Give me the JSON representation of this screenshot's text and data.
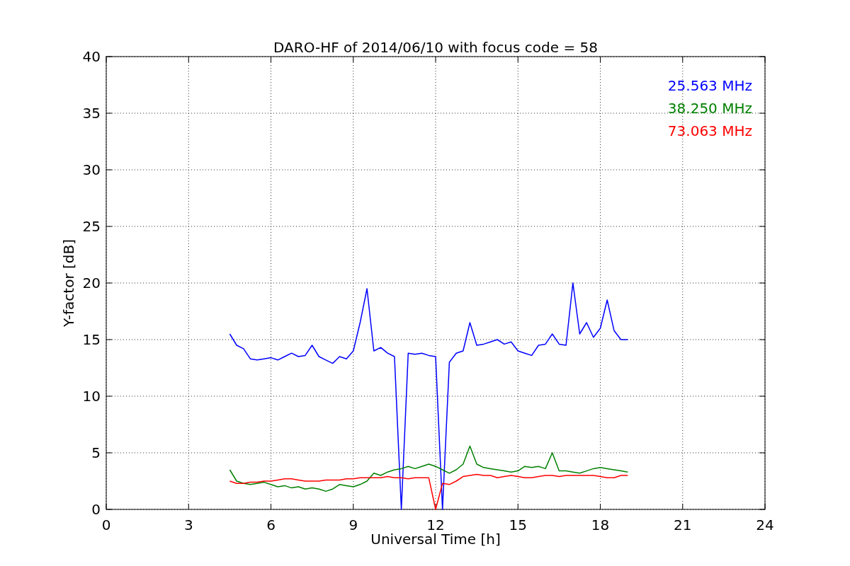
{
  "figure": {
    "chart_data": {
      "type": "line",
      "title": "DARO-HF of 2014/06/10 with focus code = 58",
      "xlabel": "Universal Time [h]",
      "ylabel": "Y-factor [dB]",
      "x": [
        4.5,
        4.75,
        5,
        5.25,
        5.5,
        5.75,
        6,
        6.25,
        6.5,
        6.75,
        7,
        7.25,
        7.5,
        7.75,
        8,
        8.25,
        8.5,
        8.75,
        9,
        9.25,
        9.5,
        9.75,
        10,
        10.25,
        10.5,
        10.75,
        11,
        11.25,
        11.5,
        11.75,
        12,
        12.25,
        12.5,
        12.75,
        13,
        13.25,
        13.5,
        13.75,
        14,
        14.25,
        14.5,
        14.75,
        15,
        15.25,
        15.5,
        15.75,
        16,
        16.25,
        16.5,
        16.75,
        17,
        17.25,
        17.5,
        17.75,
        18,
        18.25,
        18.5,
        18.75,
        19
      ],
      "series": [
        {
          "name": "25.563 MHz",
          "color": "#0000ff",
          "values": [
            15.5,
            14.5,
            14.2,
            13.3,
            13.2,
            13.3,
            13.4,
            13.2,
            13.5,
            13.8,
            13.5,
            13.6,
            14.5,
            13.5,
            13.2,
            12.9,
            13.5,
            13.3,
            14.0,
            16.5,
            19.5,
            14.0,
            14.3,
            13.8,
            13.5,
            0,
            13.8,
            13.7,
            13.8,
            13.6,
            13.5,
            0,
            13.0,
            13.8,
            14.0,
            16.5,
            14.5,
            14.6,
            14.8,
            15.0,
            14.6,
            14.8,
            14.0,
            13.8,
            13.6,
            14.5,
            14.6,
            15.5,
            14.6,
            14.5,
            20,
            15.5,
            16.5,
            15.2,
            16,
            18.5,
            15.8,
            15.0,
            15.0
          ]
        },
        {
          "name": "38.250 MHz",
          "color": "#008000",
          "values": [
            3.5,
            2.5,
            2.3,
            2.2,
            2.3,
            2.4,
            2.2,
            2.0,
            2.1,
            1.9,
            2.0,
            1.8,
            1.9,
            1.8,
            1.6,
            1.8,
            2.2,
            2.1,
            2.0,
            2.2,
            2.5,
            3.2,
            3.0,
            3.3,
            3.5,
            3.6,
            3.8,
            3.6,
            3.8,
            4.0,
            3.8,
            3.5,
            3.2,
            3.5,
            4.0,
            5.6,
            4.0,
            3.7,
            3.6,
            3.5,
            3.4,
            3.3,
            3.4,
            3.8,
            3.7,
            3.8,
            3.6,
            5.0,
            3.4,
            3.4,
            3.3,
            3.2,
            3.4,
            3.6,
            3.7,
            3.6,
            3.5,
            3.4,
            3.3
          ]
        },
        {
          "name": "73.063 MHz",
          "color": "#ff0000",
          "values": [
            2.5,
            2.3,
            2.3,
            2.4,
            2.4,
            2.5,
            2.5,
            2.6,
            2.7,
            2.7,
            2.6,
            2.5,
            2.5,
            2.5,
            2.6,
            2.6,
            2.6,
            2.7,
            2.7,
            2.8,
            2.8,
            2.8,
            2.8,
            2.9,
            2.8,
            2.8,
            2.7,
            2.8,
            2.8,
            2.8,
            0,
            2.3,
            2.2,
            2.5,
            2.9,
            3.0,
            3.1,
            3.0,
            3.0,
            2.8,
            2.9,
            3.0,
            2.9,
            2.8,
            2.8,
            2.9,
            3.0,
            3.0,
            2.9,
            3.0,
            3.0,
            3.0,
            3.0,
            3.0,
            2.9,
            2.8,
            2.8,
            3.0,
            3.0
          ]
        }
      ],
      "xlim": [
        0,
        24
      ],
      "ylim": [
        0,
        40
      ],
      "xticks": [
        0,
        3,
        6,
        9,
        12,
        15,
        18,
        21,
        24
      ],
      "yticks": [
        0,
        5,
        10,
        15,
        20,
        25,
        30,
        35,
        40
      ],
      "grid": true
    }
  }
}
